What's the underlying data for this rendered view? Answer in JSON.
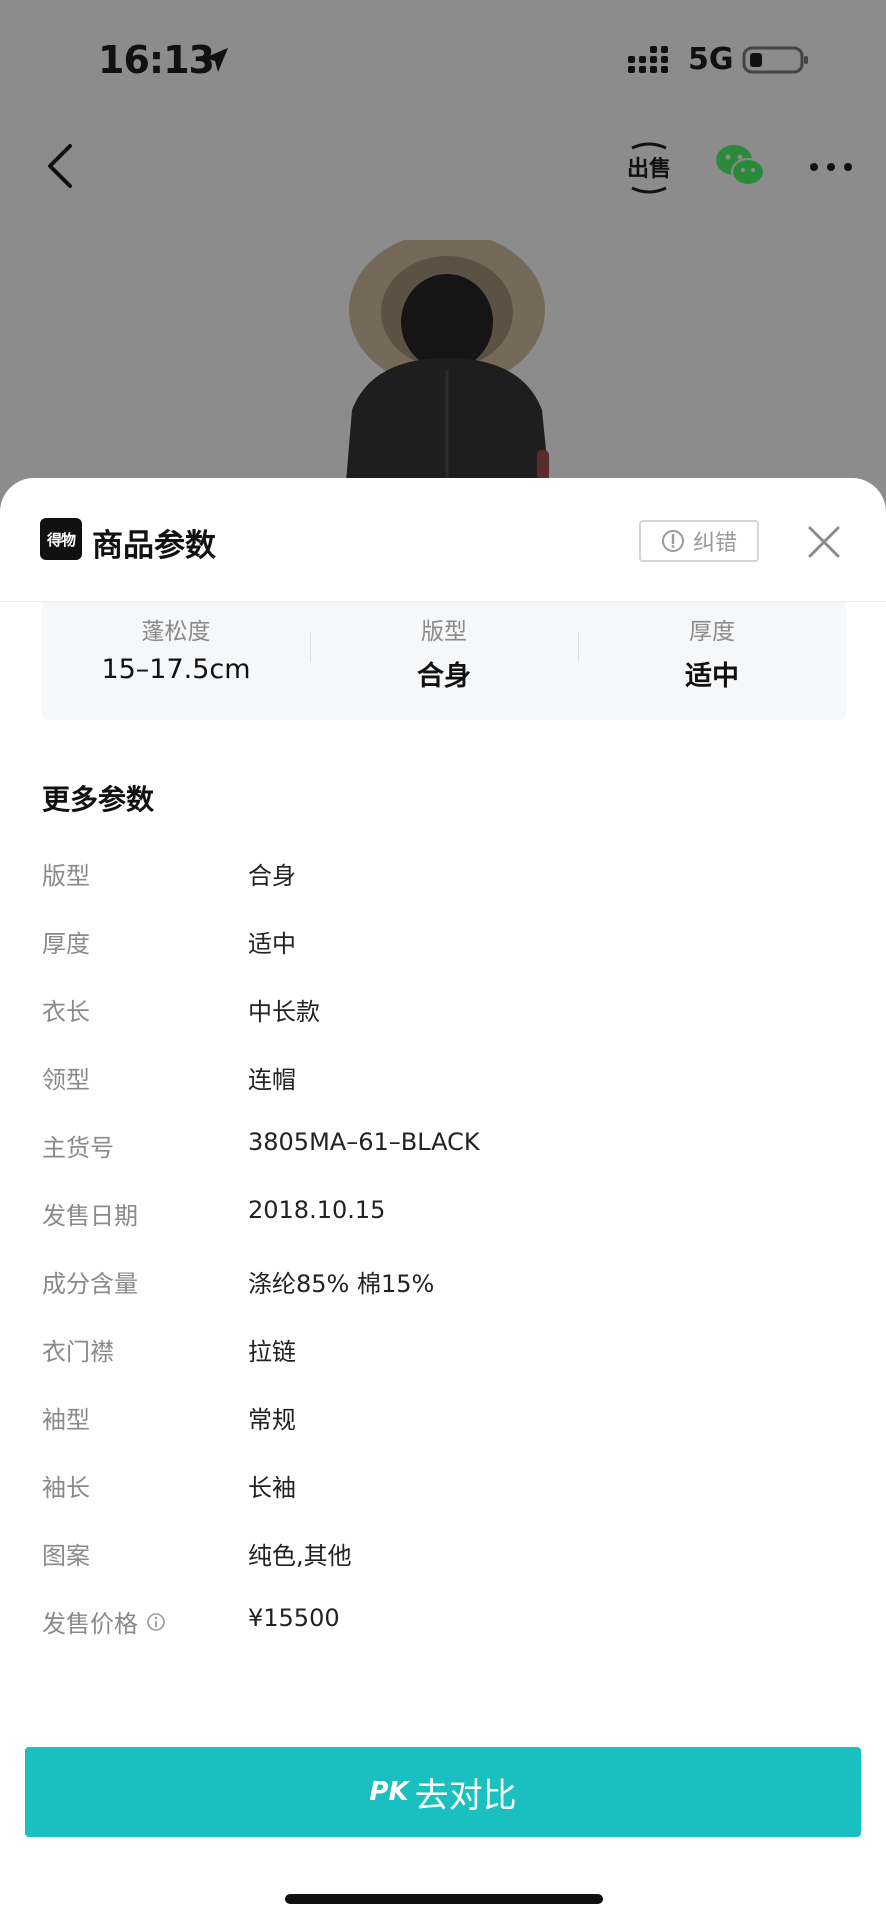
{
  "status_bar": {
    "time": "16:13",
    "network": "5G"
  },
  "nav": {
    "icons": [
      "back-icon",
      "sell-icon",
      "wechat-icon",
      "more-icon"
    ]
  },
  "sheet": {
    "logo_text": "得物",
    "title": "商品参数",
    "report_label": "纠错"
  },
  "summary": [
    {
      "label": "蓬松度",
      "value": "15–17.5cm"
    },
    {
      "label": "版型",
      "value": "合身"
    },
    {
      "label": "厚度",
      "value": "适中"
    }
  ],
  "more_params": {
    "title": "更多参数",
    "rows": [
      {
        "key": "版型",
        "value": "合身"
      },
      {
        "key": "厚度",
        "value": "适中"
      },
      {
        "key": "衣长",
        "value": "中长款"
      },
      {
        "key": "领型",
        "value": "连帽"
      },
      {
        "key": "主货号",
        "value": "3805MA–61–BLACK"
      },
      {
        "key": "发售日期",
        "value": "2018.10.15"
      },
      {
        "key": "成分含量",
        "value": "涤纶85% 棉15%"
      },
      {
        "key": "衣门襟",
        "value": "拉链"
      },
      {
        "key": "袖型",
        "value": "常规"
      },
      {
        "key": "袖长",
        "value": "长袖"
      },
      {
        "key": "图案",
        "value": "纯色,其他"
      },
      {
        "key": "发售价格",
        "value": "¥15500"
      }
    ]
  },
  "pk_button": {
    "prefix": "PK",
    "label": "去对比"
  },
  "colors": {
    "accent": "#1ac0c0",
    "backdrop": "#8c8c8c"
  }
}
